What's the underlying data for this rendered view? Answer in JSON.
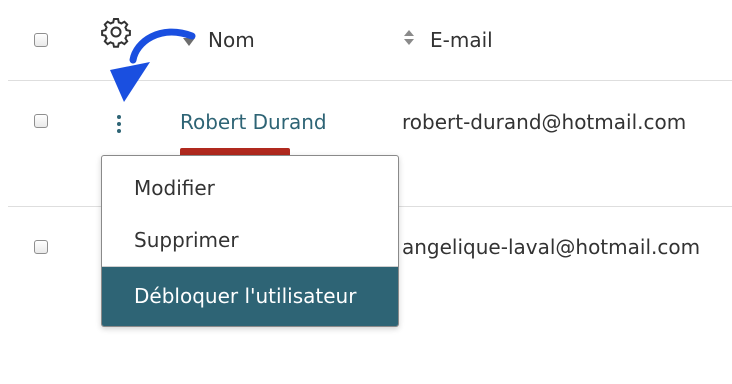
{
  "table": {
    "header": {
      "name_label": "Nom",
      "email_label": "E-mail"
    },
    "rows": [
      {
        "name": "Robert Durand",
        "email": "robert-durand@hotmail.com"
      },
      {
        "email": "angelique-laval@hotmail.com"
      }
    ]
  },
  "context_menu": {
    "items": [
      {
        "label": "Modifier"
      },
      {
        "label": "Supprimer"
      },
      {
        "label": "Débloquer l'utilisateur",
        "active": true
      }
    ]
  },
  "colors": {
    "accent": "#2e6475",
    "link": "#2e6475",
    "status_badge": "#b0291e",
    "annotation_arrow": "#1a4fe0"
  },
  "icons": {
    "settings": "gear-icon",
    "row_actions": "kebab-menu-icon",
    "sort": "sort-icon",
    "annotation": "curved-arrow-icon"
  }
}
